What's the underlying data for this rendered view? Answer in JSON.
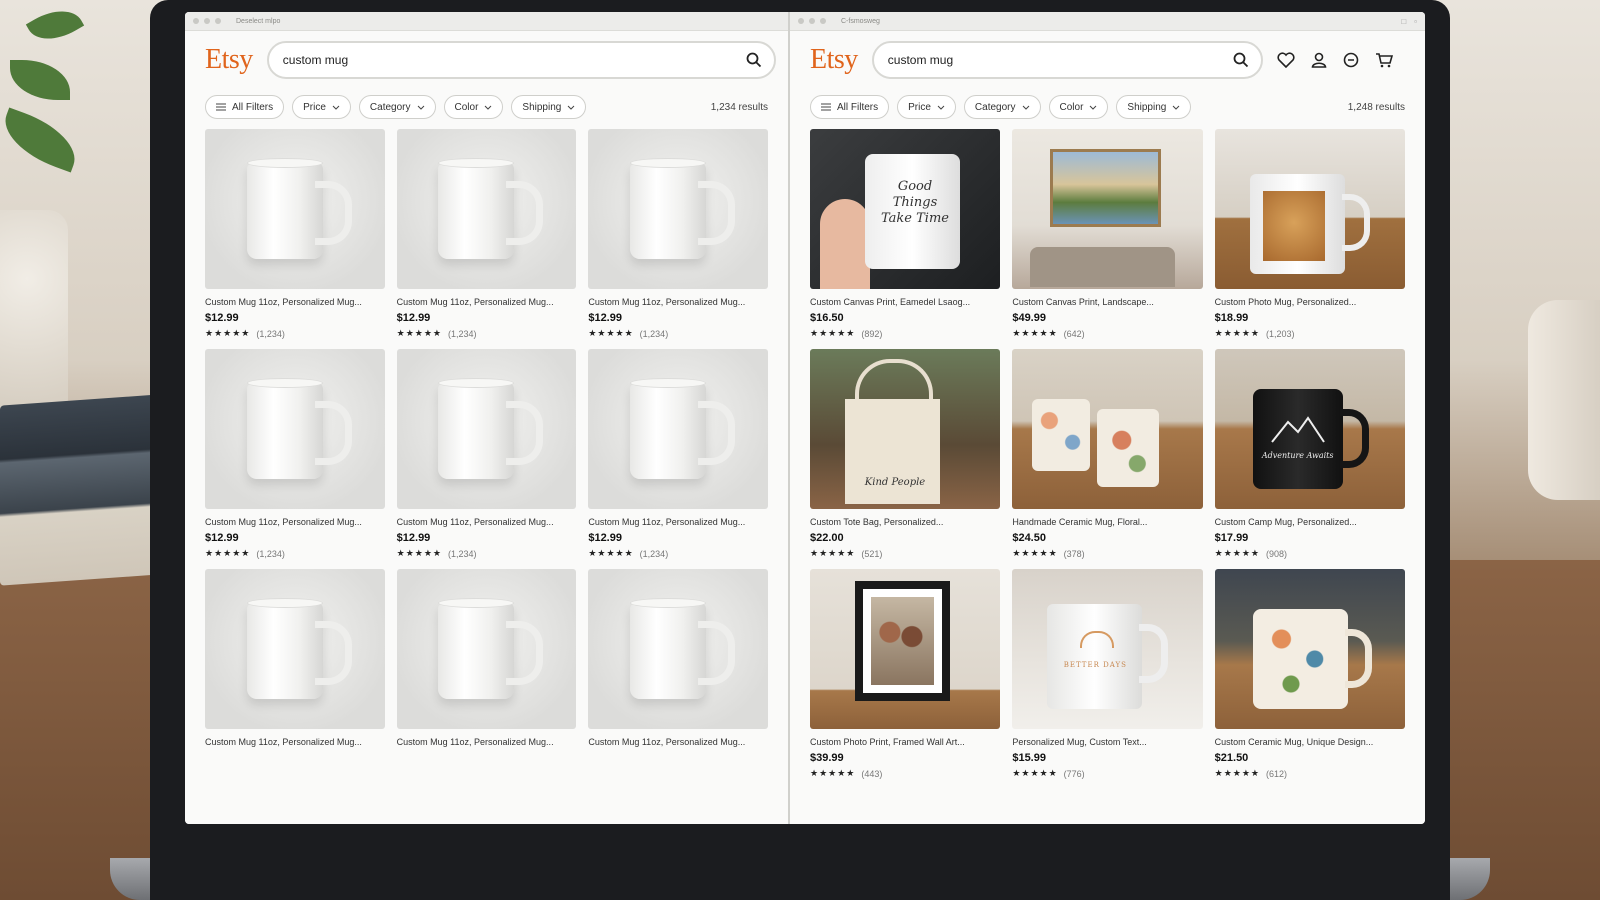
{
  "colors": {
    "brand": "#e0641c",
    "chip_border": "#cfcfcb",
    "text": "#333333"
  },
  "left": {
    "window_title": "Deselect mlpo",
    "logo": "Etsy",
    "search": {
      "value": "custom mug",
      "icon": "search-icon"
    },
    "filters": [
      "All Filters",
      "Price",
      "Category",
      "Color",
      "Shipping"
    ],
    "results": "1,234 results",
    "products": [
      {
        "title": "Custom Mug 11oz, Personalized Mug...",
        "price": "$12.99",
        "stars": "★★★★★",
        "count": "(1,234)"
      },
      {
        "title": "Custom Mug 11oz, Personalized Mug...",
        "price": "$12.99",
        "stars": "★★★★★",
        "count": "(1,234)"
      },
      {
        "title": "Custom Mug 11oz, Personalized Mug...",
        "price": "$12.99",
        "stars": "★★★★★",
        "count": "(1,234)"
      },
      {
        "title": "Custom Mug 11oz, Personalized Mug...",
        "price": "$12.99",
        "stars": "★★★★★",
        "count": "(1,234)"
      },
      {
        "title": "Custom Mug 11oz, Personalized Mug...",
        "price": "$12.99",
        "stars": "★★★★★",
        "count": "(1,234)"
      },
      {
        "title": "Custom Mug 11oz, Personalized Mug...",
        "price": "$12.99",
        "stars": "★★★★★",
        "count": "(1,234)"
      },
      {
        "title": "Custom Mug 11oz, Personalized Mug...",
        "price": "",
        "stars": "",
        "count": ""
      },
      {
        "title": "Custom Mug 11oz, Personalized Mug...",
        "price": "",
        "stars": "",
        "count": ""
      },
      {
        "title": "Custom Mug 11oz, Personalized Mug...",
        "price": "",
        "stars": "",
        "count": ""
      }
    ]
  },
  "right": {
    "window_title": "C-fsmosweg",
    "logo": "Etsy",
    "search": {
      "value": "custom mug",
      "icon": "search-icon"
    },
    "header_icons": [
      "heart-icon",
      "user-icon",
      "message-icon",
      "cart-icon"
    ],
    "filters": [
      "All Filters",
      "Price",
      "Category",
      "Color",
      "Shipping"
    ],
    "results": "1,248 results",
    "products": [
      {
        "title": "Custom Canvas Print, Eamedel Lsaog...",
        "price": "$16.50",
        "stars": "★★★★★",
        "count": "(892)",
        "photo_text": "Good Things Take Time"
      },
      {
        "title": "Custom Canvas Print, Landscape...",
        "price": "$49.99",
        "stars": "★★★★★",
        "count": "(642)",
        "photo_text": ""
      },
      {
        "title": "Custom Photo Mug, Personalized...",
        "price": "$18.99",
        "stars": "★★★★★",
        "count": "(1,203)",
        "photo_text": ""
      },
      {
        "title": "Custom Tote Bag, Personalized...",
        "price": "$22.00",
        "stars": "★★★★★",
        "count": "(521)",
        "photo_text": "Kind People"
      },
      {
        "title": "Handmade Ceramic Mug, Floral...",
        "price": "$24.50",
        "stars": "★★★★★",
        "count": "(378)",
        "photo_text": ""
      },
      {
        "title": "Custom Camp Mug, Personalized...",
        "price": "$17.99",
        "stars": "★★★★★",
        "count": "(908)",
        "photo_text": "Adventure Awaits"
      },
      {
        "title": "Custom Photo Print, Framed Wall Art...",
        "price": "$39.99",
        "stars": "★★★★★",
        "count": "(443)",
        "photo_text": ""
      },
      {
        "title": "Personalized Mug, Custom Text...",
        "price": "$15.99",
        "stars": "★★★★★",
        "count": "(776)",
        "photo_text": "BETTER DAYS"
      },
      {
        "title": "Custom Ceramic Mug, Unique Design...",
        "price": "$21.50",
        "stars": "★★★★★",
        "count": "(612)",
        "photo_text": ""
      }
    ]
  }
}
